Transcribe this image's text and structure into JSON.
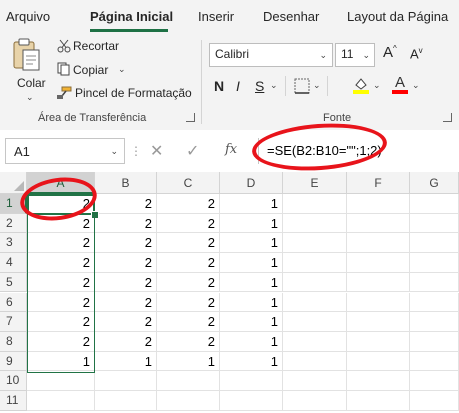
{
  "tabs": [
    "Arquivo",
    "Página Inicial",
    "Inserir",
    "Desenhar",
    "Layout da Página"
  ],
  "active_tab": "Página Inicial",
  "clipboard": {
    "paste_label": "Colar",
    "cut_label": "Recortar",
    "copy_label": "Copiar",
    "format_painter_label": "Pincel de Formatação",
    "group_label": "Área de Transferência"
  },
  "font": {
    "name": "Calibri",
    "size": "11",
    "group_label": "Fonte",
    "bold": "N",
    "italic": "I",
    "underline": "S",
    "grow": "A",
    "shrink": "A",
    "font_color_glyph": "A",
    "highlight_color": "#ffff00",
    "font_color": "#ff0000"
  },
  "formula_bar": {
    "name_box": "A1",
    "fx": "fx",
    "formula": "=SE(B2:B10=\"\";1;2)"
  },
  "sheet": {
    "columns": [
      "A",
      "B",
      "C",
      "D",
      "E",
      "F",
      "G"
    ],
    "rows": [
      "1",
      "2",
      "3",
      "4",
      "5",
      "6",
      "7",
      "8",
      "9",
      "10",
      "11"
    ],
    "values": [
      [
        "2",
        "2",
        "2",
        "1"
      ],
      [
        "2",
        "2",
        "2",
        "1"
      ],
      [
        "2",
        "2",
        "2",
        "1"
      ],
      [
        "2",
        "2",
        "2",
        "1"
      ],
      [
        "2",
        "2",
        "2",
        "1"
      ],
      [
        "2",
        "2",
        "2",
        "1"
      ],
      [
        "2",
        "2",
        "2",
        "1"
      ],
      [
        "2",
        "2",
        "2",
        "1"
      ],
      [
        "1",
        "1",
        "1",
        "1"
      ]
    ],
    "selected_cell": "A1",
    "accent": "#217346",
    "annotation_color": "#e8141b"
  }
}
